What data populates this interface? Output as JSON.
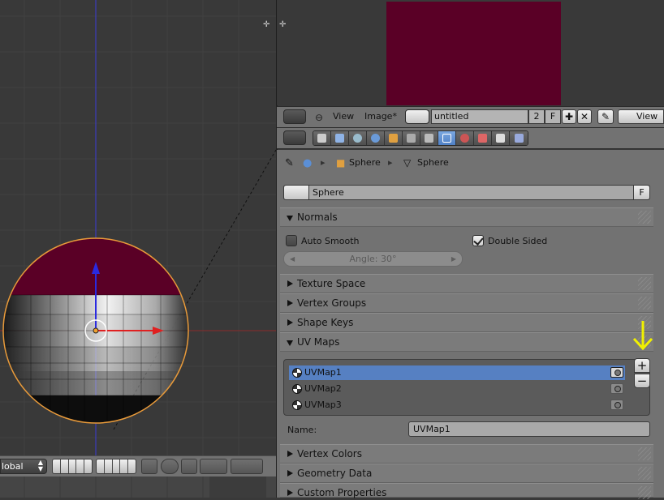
{
  "viewport": {
    "orientation_label": "lobal"
  },
  "image_editor": {
    "menu_view": "View",
    "menu_image": "Image*",
    "image_name": "untitled",
    "users_count": "2",
    "fake_user": "F",
    "view_mode": "View"
  },
  "properties": {
    "breadcrumb_object": "Sphere",
    "breadcrumb_mesh": "Sphere",
    "datablock_name": "Sphere",
    "datablock_fake": "F",
    "panels": {
      "normals": "Normals",
      "texture_space": "Texture Space",
      "vertex_groups": "Vertex Groups",
      "shape_keys": "Shape Keys",
      "uv_maps": "UV Maps",
      "vertex_colors": "Vertex Colors",
      "geometry_data": "Geometry Data",
      "custom_properties": "Custom Properties"
    },
    "normals": {
      "auto_smooth_label": "Auto Smooth",
      "auto_smooth_checked": false,
      "double_sided_label": "Double Sided",
      "double_sided_checked": true,
      "angle_label": "Angle: 30°"
    },
    "uv_maps": {
      "items": [
        {
          "name": "UVMap1",
          "active": true
        },
        {
          "name": "UVMap2",
          "active": false
        },
        {
          "name": "UVMap3",
          "active": false
        }
      ],
      "add_label": "+",
      "remove_label": "−",
      "name_label": "Name:",
      "name_value": "UVMap1"
    }
  },
  "colors": {
    "image_color": "#5a0026",
    "selection_blue": "#5680c2",
    "annotation_arrow": "#f0f000"
  }
}
